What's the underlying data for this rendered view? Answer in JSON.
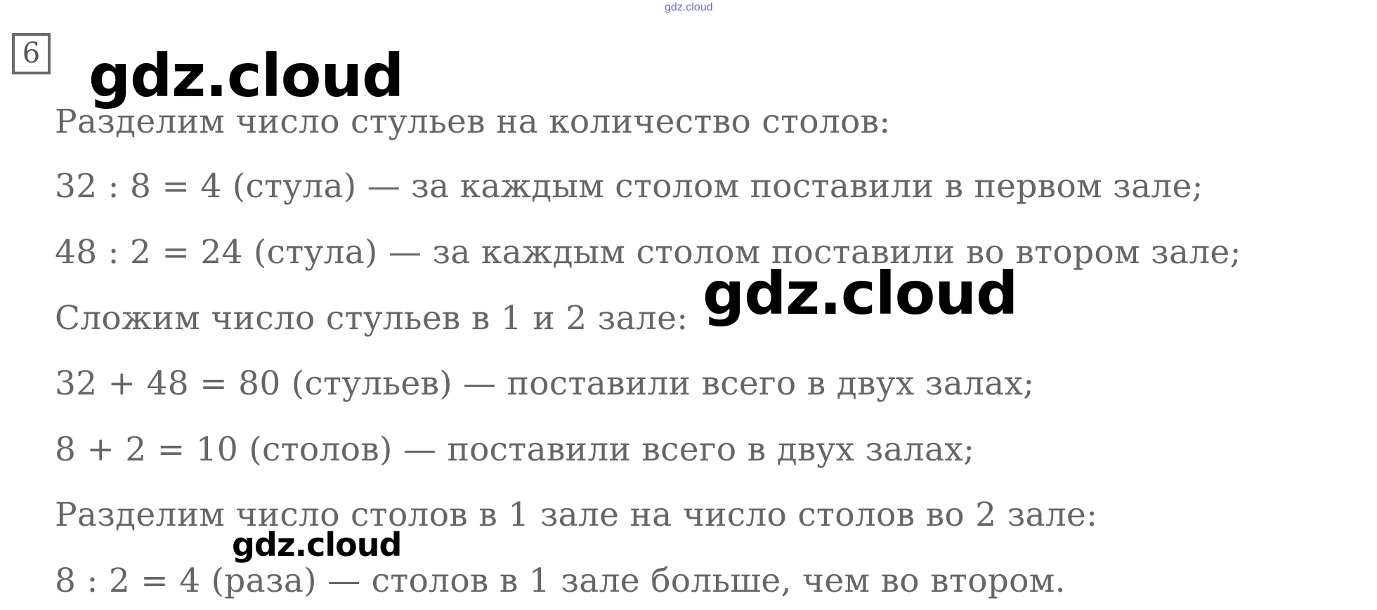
{
  "watermark_top": "gdz.cloud",
  "task_number": "6",
  "watermarks": [
    "gdz.cloud",
    "gdz.cloud",
    "gdz.cloud"
  ],
  "lines": [
    "Разделим число стульев на количество столов:",
    "32 : 8 = 4 (стула) — за каждым столом поставили в первом зале;",
    "48 : 2 = 24 (стула) — за каждым столом поставили во втором зале;",
    "Сложим число стульев в 1 и 2 зале:",
    "32 + 48 = 80 (стульев) — поставили всего в двух залах;",
    "8 + 2 = 10 (столов) — поставили всего в двух залах;",
    "Разделим число столов в 1 зале на число столов во 2 зале:",
    "8 : 2 = 4 (раза) — столов в 1 зале больше, чем во втором."
  ]
}
